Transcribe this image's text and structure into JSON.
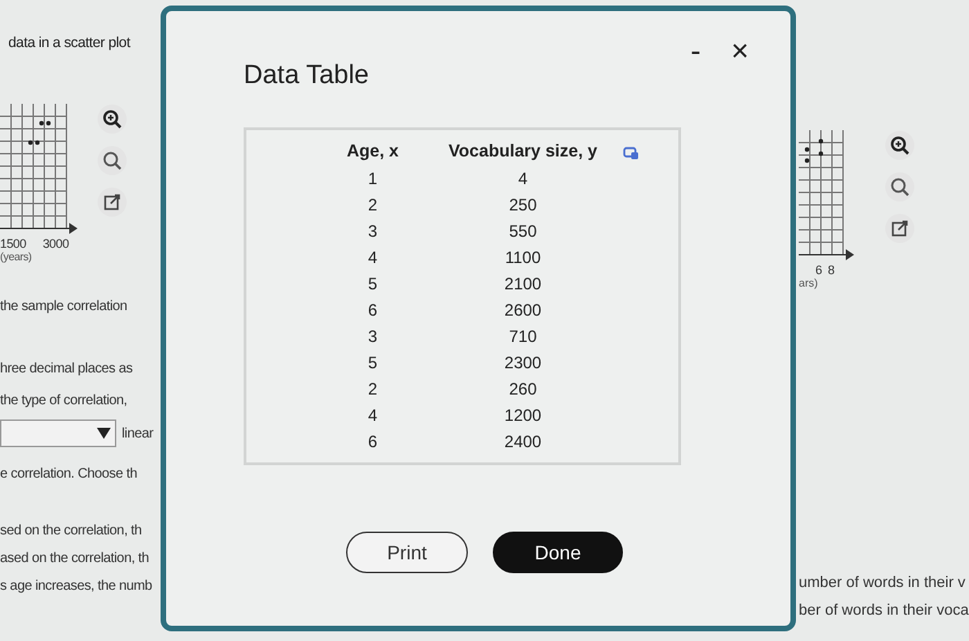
{
  "left_panel": {
    "heading": "data in a scatter plot",
    "plot": {
      "ticks": [
        "1500",
        "3000"
      ],
      "axis_label": "(years)"
    },
    "lines": [
      "the sample correlation",
      "hree decimal places as",
      "the type of correlation,"
    ],
    "dropdown": {
      "suffix": "linear"
    },
    "lines_after": [
      "e correlation. Choose th",
      "sed on the correlation, th",
      "ased on the correlation, th",
      "s age increases, the numb"
    ]
  },
  "right_panel": {
    "plot": {
      "ticks": [
        "6",
        "8"
      ],
      "axis_label": "ars)"
    },
    "lines": [
      "umber of words in their v",
      "ber of words in their voca"
    ]
  },
  "dialog": {
    "title": "Data Table",
    "minimize": "-",
    "close": "×",
    "table": {
      "columns": [
        "Age, x",
        "Vocabulary size, y"
      ],
      "rows": [
        [
          "1",
          "4"
        ],
        [
          "2",
          "250"
        ],
        [
          "3",
          "550"
        ],
        [
          "4",
          "1100"
        ],
        [
          "5",
          "2100"
        ],
        [
          "6",
          "2600"
        ],
        [
          "3",
          "710"
        ],
        [
          "5",
          "2300"
        ],
        [
          "2",
          "260"
        ],
        [
          "4",
          "1200"
        ],
        [
          "6",
          "2400"
        ]
      ]
    },
    "buttons": [
      {
        "label": "Print",
        "kind": "secondary"
      },
      {
        "label": "Done",
        "kind": "primary"
      }
    ]
  }
}
